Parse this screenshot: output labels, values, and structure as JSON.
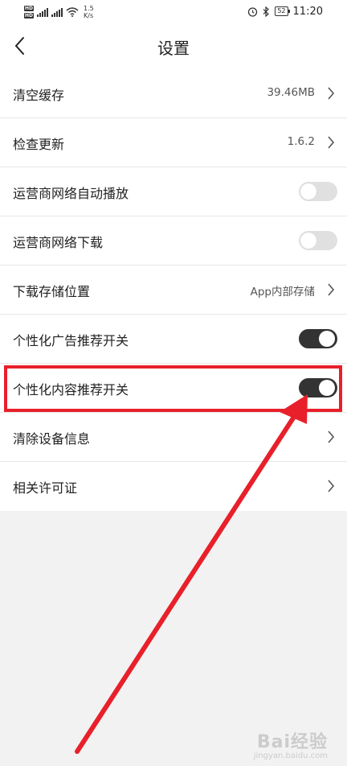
{
  "status_bar": {
    "network_speed_value": "1.5",
    "network_speed_unit": "K/s",
    "battery": "52",
    "time": "11:20",
    "icons": [
      "hd-icon",
      "signal-icon",
      "wifi-icon",
      "alarm-icon",
      "bluetooth-icon",
      "battery-icon"
    ]
  },
  "header": {
    "title": "设置",
    "back_icon": "chevron-left-icon"
  },
  "settings": {
    "items": [
      {
        "label": "清空缓存",
        "value": "39.46MB",
        "control": "chevron"
      },
      {
        "label": "检查更新",
        "value": "1.6.2",
        "control": "chevron"
      },
      {
        "label": "运营商网络自动播放",
        "control": "toggle",
        "state": "off"
      },
      {
        "label": "运营商网络下载",
        "control": "toggle",
        "state": "off"
      },
      {
        "label": "下载存储位置",
        "value": "App内部存储",
        "control": "chevron"
      },
      {
        "label": "个性化广告推荐开关",
        "control": "toggle",
        "state": "on"
      },
      {
        "label": "个性化内容推荐开关",
        "control": "toggle",
        "state": "on"
      },
      {
        "label": "清除设备信息",
        "control": "chevron"
      },
      {
        "label": "相关许可证",
        "control": "chevron"
      }
    ]
  },
  "annotation": {
    "highlight_color": "#e8202a",
    "highlighted_item": "个性化内容推荐开关"
  },
  "watermark": {
    "text": "Bai经验",
    "sub": "jingyan.baidu.com"
  }
}
